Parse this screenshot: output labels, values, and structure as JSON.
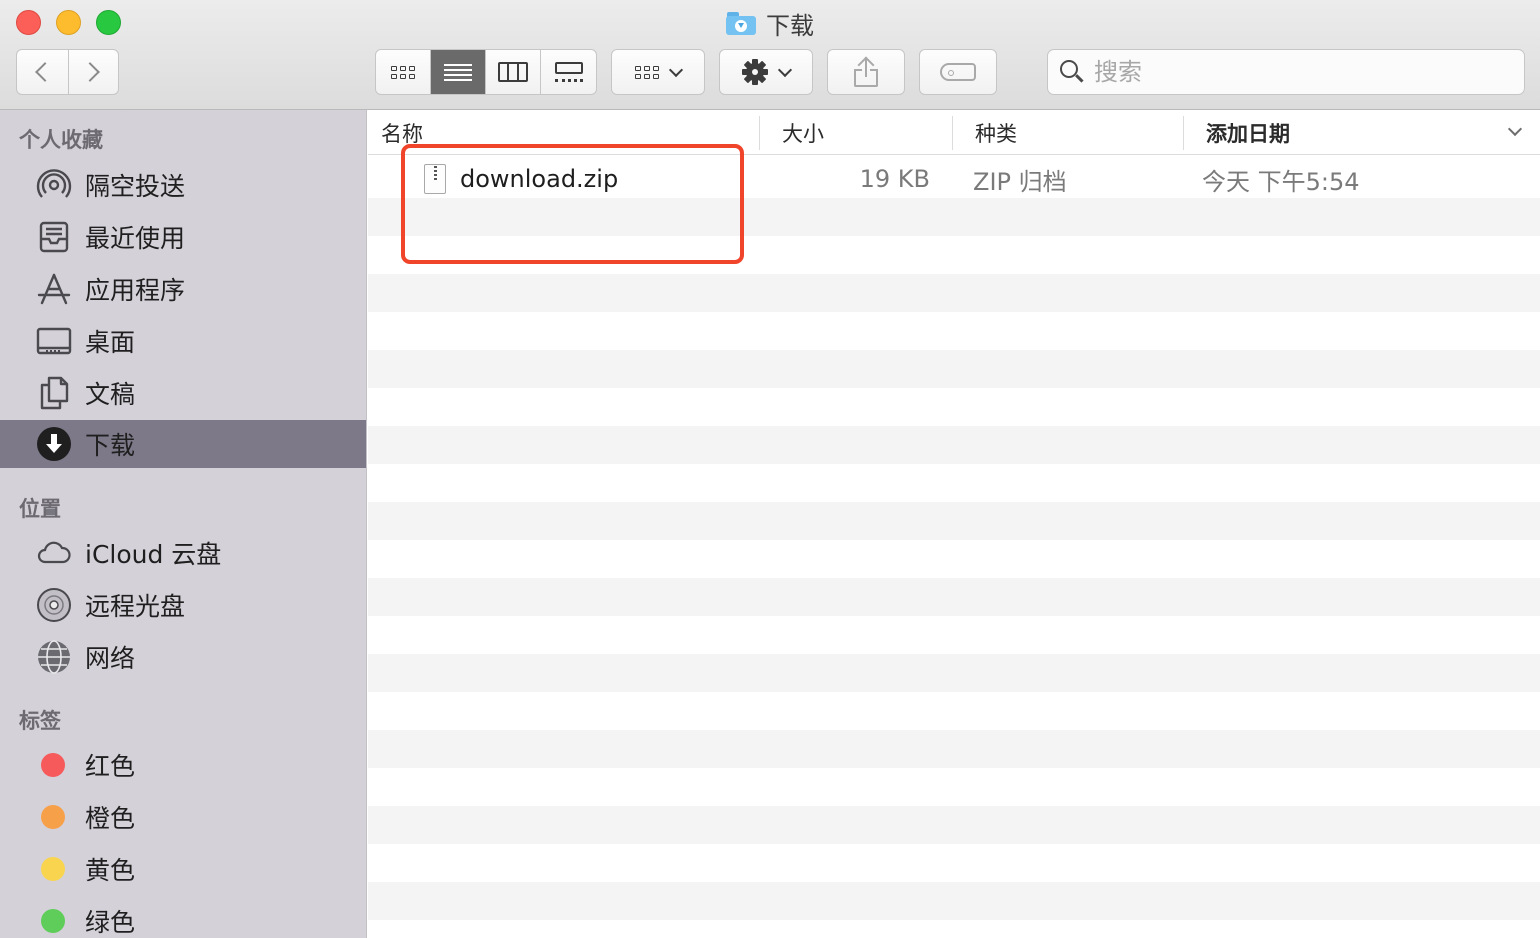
{
  "window": {
    "title": "下载"
  },
  "toolbar": {
    "back_icon": "chevron-left-icon",
    "forward_icon": "chevron-right-icon",
    "view_modes": [
      "icon-view",
      "list-view",
      "column-view",
      "gallery-view"
    ],
    "active_view": "list-view",
    "arrange_icon": "group-grid-icon",
    "action_icon": "gear-icon",
    "share_icon": "share-icon",
    "tag_icon": "tag-icon",
    "search_placeholder": "搜索"
  },
  "sidebar": {
    "favorites_header": "个人收藏",
    "favorites": [
      {
        "label": "隔空投送",
        "icon": "airdrop-icon"
      },
      {
        "label": "最近使用",
        "icon": "recents-icon"
      },
      {
        "label": "应用程序",
        "icon": "applications-icon"
      },
      {
        "label": "桌面",
        "icon": "desktop-icon"
      },
      {
        "label": "文稿",
        "icon": "documents-icon"
      },
      {
        "label": "下载",
        "icon": "downloads-icon",
        "selected": true
      }
    ],
    "locations_header": "位置",
    "locations": [
      {
        "label": "iCloud 云盘",
        "icon": "icloud-icon"
      },
      {
        "label": "远程光盘",
        "icon": "remote-disc-icon"
      },
      {
        "label": "网络",
        "icon": "network-icon"
      }
    ],
    "tags_header": "标签",
    "tags": [
      {
        "label": "红色",
        "color": "#f65a5a"
      },
      {
        "label": "橙色",
        "color": "#f7a04a"
      },
      {
        "label": "黄色",
        "color": "#f9d54f"
      },
      {
        "label": "绿色",
        "color": "#5fcd5a"
      }
    ]
  },
  "file_list": {
    "columns": {
      "name": "名称",
      "size": "大小",
      "kind": "种类",
      "date_added": "添加日期"
    },
    "sort_column": "date_added",
    "files": [
      {
        "name": "download.zip",
        "size": "19 KB",
        "kind": "ZIP 归档",
        "date_added": "今天 下午5:54",
        "icon": "zip-file-icon"
      }
    ]
  },
  "annotation": {
    "highlight_color": "#f0442b"
  }
}
